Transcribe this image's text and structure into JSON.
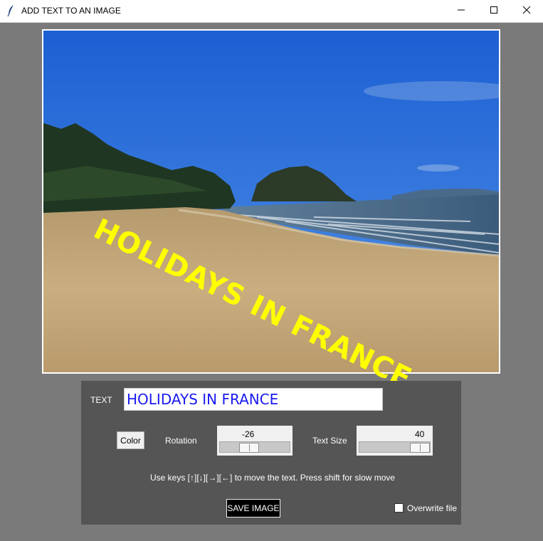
{
  "window": {
    "title": "ADD TEXT TO AN IMAGE",
    "icon": "feather-icon",
    "controls": [
      "minimize-icon",
      "maximize-icon",
      "close-icon"
    ]
  },
  "image": {
    "description_icon": "beach-photo",
    "overlay_text": "HOLIDAYS IN FRANCE",
    "overlay_color": "#ffff00"
  },
  "controls": {
    "text_label": "TEXT",
    "text_value": "HOLIDAYS IN FRANCE",
    "text_color": "#1a1af0",
    "color_button": "Color",
    "rotation_label": "Rotation",
    "rotation_value": "-26",
    "text_size_label": "Text Size",
    "text_size_value": "40",
    "hint": "Use keys [↑][↓][→][←] to move the text. Press shift for slow move",
    "save_button": "SAVE IMAGE",
    "overwrite_label": "Overwrite file",
    "overwrite_checked": false
  },
  "colors": {
    "background": "#7a7a7a",
    "panel": "#555555",
    "save_button_bg": "#000000"
  }
}
